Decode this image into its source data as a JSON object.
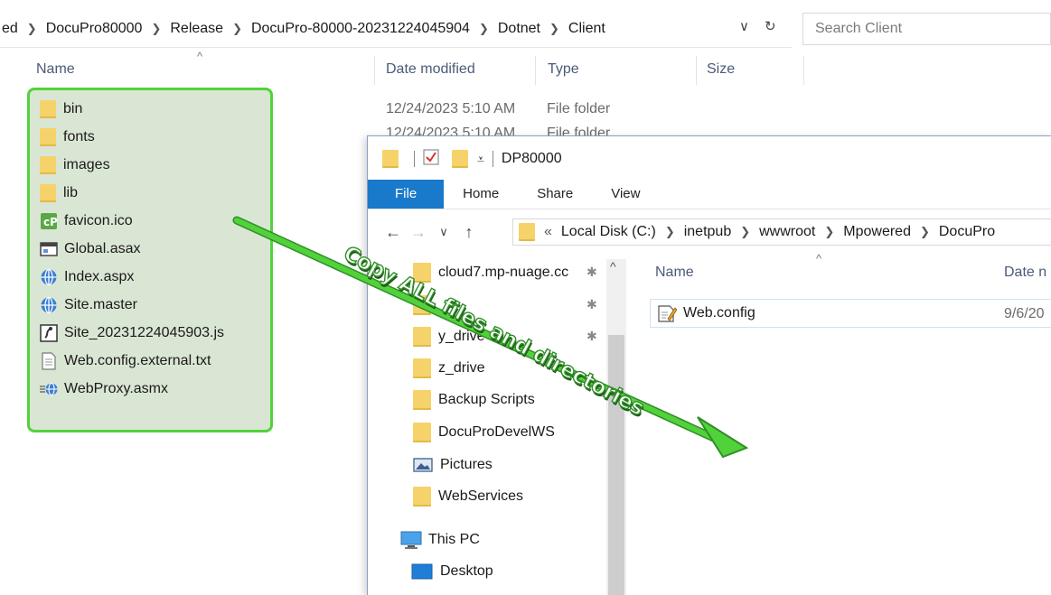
{
  "back_window": {
    "breadcrumb": [
      "ed",
      "DocuPro80000",
      "Release",
      "DocuPro-80000-20231224045904",
      "Dotnet",
      "Client"
    ],
    "search_placeholder": "Search Client",
    "columns": {
      "name": "Name",
      "date_modified": "Date modified",
      "type": "Type",
      "size": "Size"
    },
    "items": [
      {
        "name": "bin",
        "icon": "folder-icon",
        "date": "12/24/2023 5:10 AM",
        "type": "File folder"
      },
      {
        "name": "fonts",
        "icon": "folder-icon",
        "date": "12/24/2023 5:10 AM",
        "type": "File folder"
      },
      {
        "name": "images",
        "icon": "folder-icon"
      },
      {
        "name": "lib",
        "icon": "folder-icon"
      },
      {
        "name": "favicon.ico",
        "icon": "favicon-icon"
      },
      {
        "name": "Global.asax",
        "icon": "asax-file-icon"
      },
      {
        "name": "Index.aspx",
        "icon": "globe-icon"
      },
      {
        "name": "Site.master",
        "icon": "globe-icon"
      },
      {
        "name": "Site_20231224045903.js",
        "icon": "script-file-icon"
      },
      {
        "name": "Web.config.external.txt",
        "icon": "text-file-icon"
      },
      {
        "name": "WebProxy.asmx",
        "icon": "web-service-icon"
      }
    ]
  },
  "front_window": {
    "title": "DP80000",
    "ribbon_tabs": [
      "File",
      "Home",
      "Share",
      "View"
    ],
    "address": [
      "«",
      "Local Disk (C:)",
      "inetpub",
      "wwwroot",
      "Mpowered",
      "DocuPro"
    ],
    "nav_items": [
      {
        "label": "cloud7.mp-nuage.cc",
        "icon": "folder-icon",
        "pinned": true
      },
      {
        "label": "",
        "icon": "folder-icon",
        "pinned": true
      },
      {
        "label": "y_drive",
        "icon": "folder-icon",
        "pinned": true
      },
      {
        "label": "z_drive",
        "icon": "folder-icon"
      },
      {
        "label": "Backup Scripts",
        "icon": "folder-icon"
      },
      {
        "label": "DocuProDevelWS",
        "icon": "folder-icon"
      },
      {
        "label": "Pictures",
        "icon": "pictures-icon"
      },
      {
        "label": "WebServices",
        "icon": "folder-icon"
      },
      {
        "label": "This PC",
        "icon": "this-pc-icon"
      },
      {
        "label": "Desktop",
        "icon": "desktop-icon"
      }
    ],
    "columns": {
      "name": "Name",
      "date": "Date n"
    },
    "files": [
      {
        "name": "Web.config",
        "date": "9/6/20",
        "icon": "config-file-icon"
      }
    ]
  },
  "annotation": {
    "text": "Copy ALL files and directories",
    "color": "#52d23a"
  }
}
